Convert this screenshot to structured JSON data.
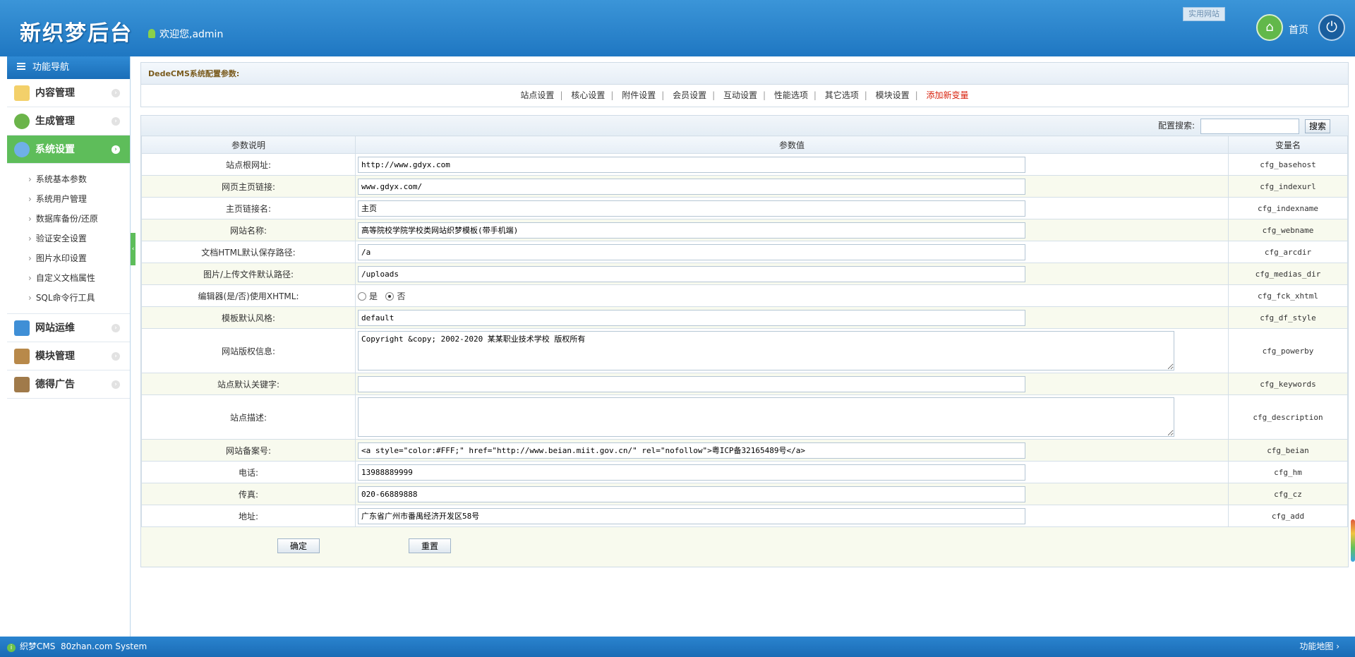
{
  "header": {
    "logo": "新织梦后台",
    "welcome": "欢迎您,admin",
    "top_button": "实用网站",
    "home_label": "首页"
  },
  "sidebar": {
    "title": "功能导航",
    "menus": [
      {
        "label": "内容管理",
        "color": "#f3d06a"
      },
      {
        "label": "生成管理",
        "color": "#6bb44a"
      },
      {
        "label": "系统设置",
        "color": "#6fb0e8"
      }
    ],
    "sub_items": [
      "系统基本参数",
      "系统用户管理",
      "数据库备份/还原",
      "验证安全设置",
      "图片水印设置",
      "自定义文档属性",
      "SQL命令行工具"
    ],
    "menus_after": [
      {
        "label": "网站运维",
        "color": "#3f8fd6"
      },
      {
        "label": "模块管理",
        "color": "#b8894a"
      },
      {
        "label": "德得广告",
        "color": "#a07a4a"
      }
    ]
  },
  "config": {
    "title": "DedeCMS系统配置参数:",
    "tabs": [
      "站点设置",
      "核心设置",
      "附件设置",
      "会员设置",
      "互动设置",
      "性能选项",
      "其它选项",
      "模块设置"
    ],
    "add_var": "添加新变量",
    "search_label": "配置搜索:",
    "search_button": "搜索"
  },
  "table": {
    "headers": [
      "参数说明",
      "参数值",
      "变量名"
    ],
    "rows": [
      {
        "label": "站点根网址:",
        "value": "http://www.gdyx.com",
        "name": "cfg_basehost"
      },
      {
        "label": "网页主页链接:",
        "value": "www.gdyx.com/",
        "name": "cfg_indexurl"
      },
      {
        "label": "主页链接名:",
        "value": "主页",
        "name": "cfg_indexname"
      },
      {
        "label": "网站名称:",
        "value": "高等院校学院学校类网站织梦模板(带手机端)",
        "name": "cfg_webname"
      },
      {
        "label": "文档HTML默认保存路径:",
        "value": "/a",
        "name": "cfg_arcdir"
      },
      {
        "label": "图片/上传文件默认路径:",
        "value": "/uploads",
        "name": "cfg_medias_dir"
      },
      {
        "label": "编辑器(是/否)使用XHTML:",
        "radio_yes": "是",
        "radio_no": "否",
        "name": "cfg_fck_xhtml"
      },
      {
        "label": "模板默认风格:",
        "value": "default",
        "name": "cfg_df_style"
      },
      {
        "label": "网站版权信息:",
        "value": "Copyright &copy; 2002-2020 某某职业技术学校 版权所有",
        "name": "cfg_powerby"
      },
      {
        "label": "站点默认关键字:",
        "value": "",
        "name": "cfg_keywords"
      },
      {
        "label": "站点描述:",
        "value": "",
        "name": "cfg_description"
      },
      {
        "label": "网站备案号:",
        "value": "<a style=\"color:#FFF;\" href=\"http://www.beian.miit.gov.cn/\" rel=\"nofollow\">粤ICP备32165489号</a>",
        "name": "cfg_beian"
      },
      {
        "label": "电话:",
        "value": "13988889999",
        "name": "cfg_hm"
      },
      {
        "label": "传真:",
        "value": "020-66889888",
        "name": "cfg_cz"
      },
      {
        "label": "地址:",
        "value": "广东省广州市番禺经济开发区58号",
        "name": "cfg_add"
      }
    ],
    "ok_button": "确定",
    "reset_button": "重置"
  },
  "footer": {
    "brand": "织梦CMS",
    "system": "80zhan.com System",
    "sitemap": "功能地图"
  }
}
